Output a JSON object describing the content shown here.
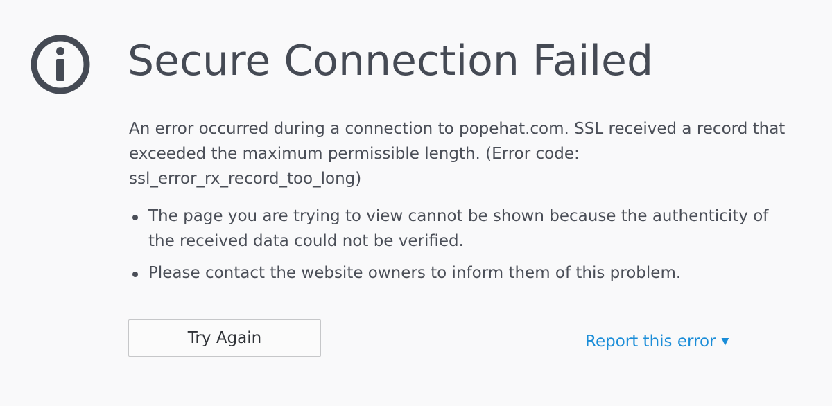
{
  "error_page": {
    "title": "Secure Connection Failed",
    "description": "An error occurred during a connection to popehat.com. SSL received a record that exceeded the maximum permissible length. (Error code: ssl_error_rx_record_too_long)",
    "bullets": [
      "The page you are trying to view cannot be shown because the authenticity of the received data could not be verified.",
      "Please contact the website owners to inform them of this problem."
    ],
    "try_again_label": "Try Again",
    "report_label": "Report this error"
  },
  "icons": {
    "info": "info-circle-icon",
    "report_chevron": "chevron-down-icon"
  },
  "colors": {
    "background": "#f9f9fa",
    "text": "#4a4e57",
    "title": "#454a54",
    "link": "#1a8dd8",
    "button_border": "#c6c7c9"
  }
}
